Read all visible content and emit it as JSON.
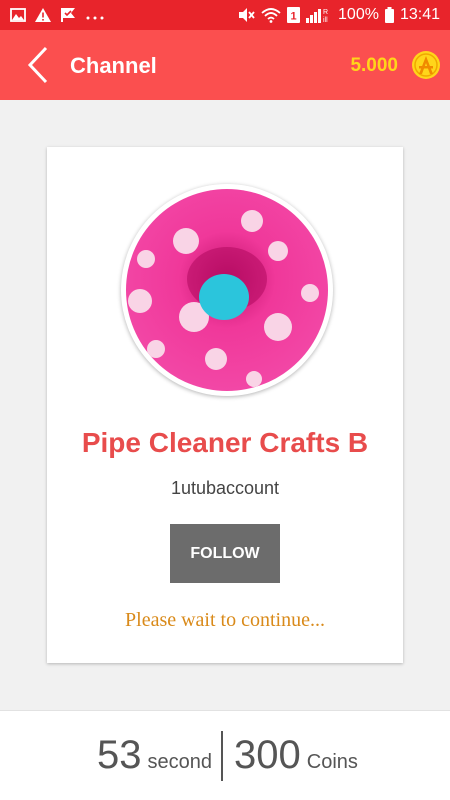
{
  "status_bar": {
    "left_icons": [
      "image-icon",
      "warning-icon",
      "check-flag-icon",
      "more-dots-icon"
    ],
    "battery": "100%",
    "time": "13:41",
    "right_icons": [
      "mute-icon",
      "wifi-icon",
      "sim-1-icon",
      "signal-icon",
      "battery-icon"
    ]
  },
  "header": {
    "title": "Channel",
    "back_icon": "back-arrow-icon",
    "coins": "5.000",
    "coin_icon": "coin-icon"
  },
  "channel": {
    "name": "Pipe Cleaner Crafts B",
    "account": "1utubaccount",
    "follow_label": "FOLLOW",
    "wait_message": "Please wait to continue..."
  },
  "footer": {
    "seconds_value": "53",
    "seconds_unit": "second",
    "coins_value": "300",
    "coins_unit": "Coins"
  },
  "colors": {
    "status_bar": "#e8242b",
    "app_bar": "#fb4f4f",
    "coin_yellow": "#ffd51a",
    "channel_name": "#e84c4c",
    "follow_button": "#6c6c6c",
    "wait_text": "#d98a1a"
  }
}
